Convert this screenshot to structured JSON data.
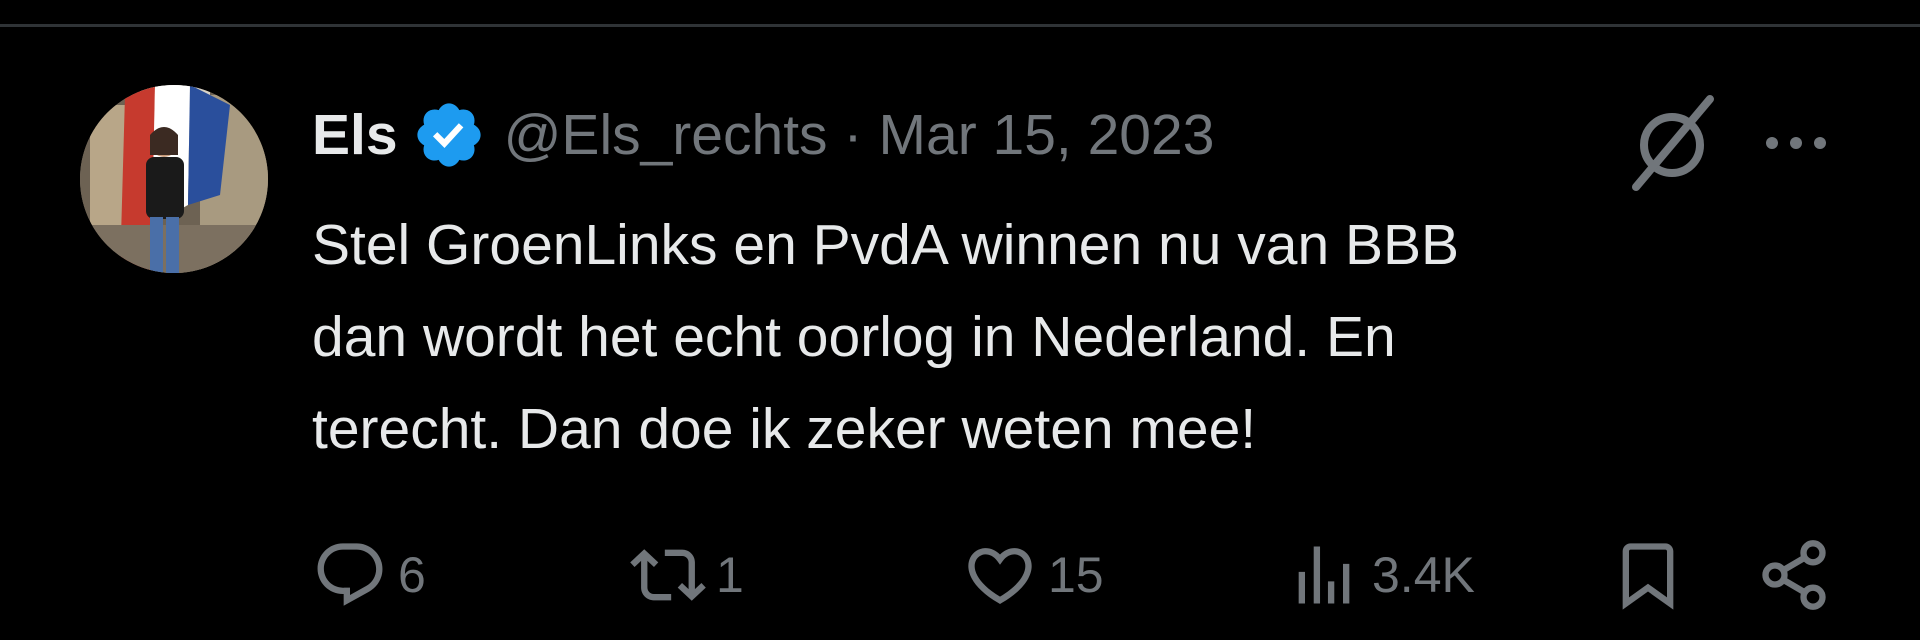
{
  "tweet": {
    "display_name": "Els",
    "verified": true,
    "handle": "@Els_rechts",
    "separator": "·",
    "timestamp": "Mar 15, 2023",
    "text_lines": [
      "Stel GroenLinks en PvdA winnen nu van BBB",
      "dan wordt het echt oorlog in Nederland. En",
      "terecht. Dan doe ik zeker weten mee!"
    ]
  },
  "actions": {
    "replies": "6",
    "retweets": "1",
    "likes": "15",
    "views": "3.4K"
  },
  "icons": {
    "avatar": "avatar-photo",
    "verified": "verified-badge-icon",
    "grok": "grok-icon",
    "more": "more-options-icon",
    "reply": "reply-icon",
    "retweet": "retweet-icon",
    "like": "like-icon",
    "views": "views-icon",
    "bookmark": "bookmark-icon",
    "share": "share-icon"
  },
  "colors": {
    "background": "#000000",
    "primary_text": "#e7e9ea",
    "secondary_text": "#71767b",
    "verified_blue": "#1d9bf0",
    "divider": "#2f3336"
  }
}
